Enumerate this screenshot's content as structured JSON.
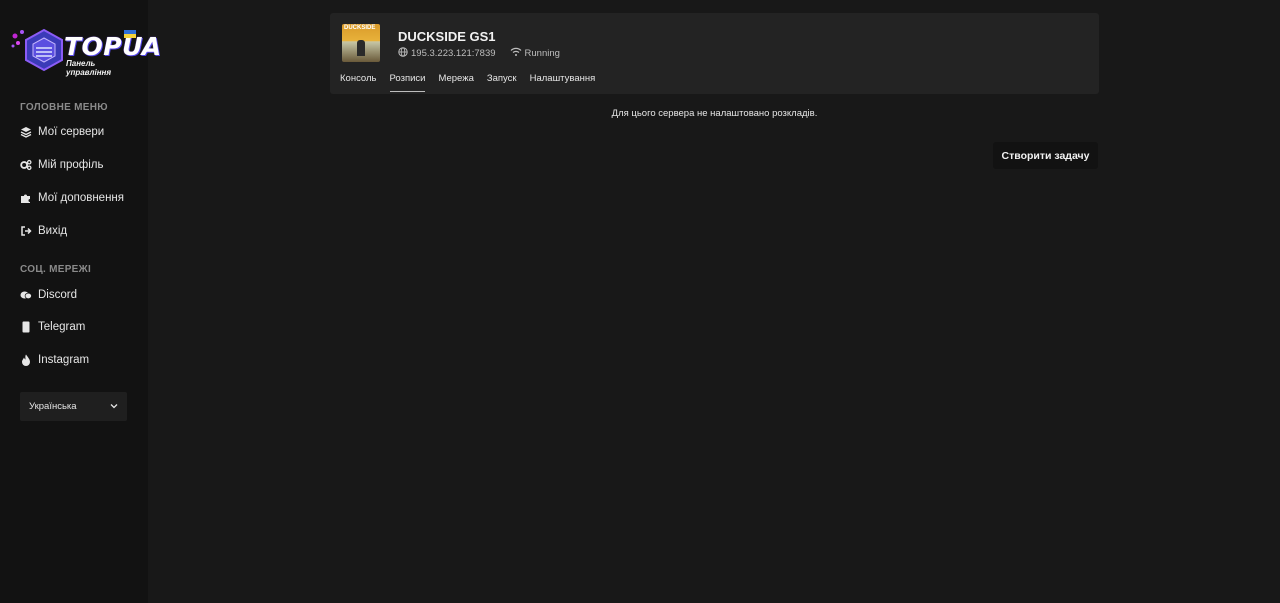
{
  "brand": {
    "name": "TOPUA",
    "subtitle": "Панель управління",
    "colors": {
      "primary": "#4f46e5",
      "accent": "#8b5cf6",
      "flag_blue": "#2f6fd6",
      "flag_yellow": "#f3d23a"
    }
  },
  "sidebar": {
    "main_menu_title": "ГОЛОВНЕ МЕНЮ",
    "main_menu": [
      {
        "label": "Мої сервери",
        "icon": "layers-icon"
      },
      {
        "label": "Мій профіль",
        "icon": "cogs-icon"
      },
      {
        "label": "Мої доповнення",
        "icon": "puzzle-icon"
      },
      {
        "label": "Вихід",
        "icon": "logout-icon"
      }
    ],
    "social_title": "СОЦ. МЕРЕЖІ",
    "social": [
      {
        "label": "Discord",
        "icon": "discord-icon"
      },
      {
        "label": "Telegram",
        "icon": "telegram-icon"
      },
      {
        "label": "Instagram",
        "icon": "instagram-icon"
      }
    ],
    "language": {
      "selected": "Українська",
      "icon": "chevron-down-icon"
    }
  },
  "server": {
    "name": "DUCKSIDE GS1",
    "thumb_text": "DUCKSIDE",
    "address": "195.3.223.121:7839",
    "status": "Running",
    "tabs": [
      {
        "label": "Консоль",
        "active": false
      },
      {
        "label": "Розписи",
        "active": true
      },
      {
        "label": "Мережа",
        "active": false
      },
      {
        "label": "Запуск",
        "active": false
      },
      {
        "label": "Налаштування",
        "active": false
      }
    ]
  },
  "schedules": {
    "empty_message": "Для цього сервера не налаштовано розкладів.",
    "create_button": "Створити задачу"
  }
}
